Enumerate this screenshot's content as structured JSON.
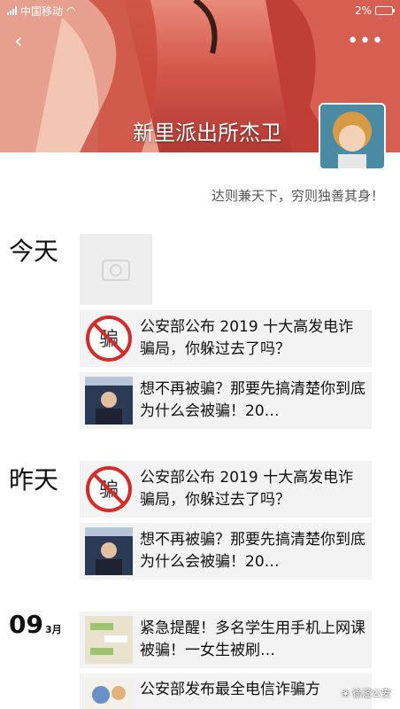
{
  "status_bar": {
    "carrier": "中国移动",
    "battery": "2%"
  },
  "header": {
    "name": "新里派出所杰卫",
    "back_icon": "back-arrow-icon",
    "more_icon": "more-dots-icon"
  },
  "signature": "达则兼天下，穷则独善其身！",
  "timeline": {
    "today": "今天",
    "yesterday": "昨天",
    "mar_day": "09",
    "mar_month": "3月"
  },
  "posts": [
    {
      "title": "公安部公布 2019 十大高发电诈骗局，你躲过去了吗？",
      "thumb": "scam-stop-icon"
    },
    {
      "title": "想不再被骗？那要先搞清楚你到底为什么会被骗！20…",
      "thumb": "news-photo"
    },
    {
      "title": "公安部公布 2019 十大高发电诈骗局，你躲过去了吗？",
      "thumb": "scam-stop-icon"
    },
    {
      "title": "想不再被骗？那要先搞清楚你到底为什么会被骗！20…",
      "thumb": "news-photo"
    },
    {
      "title": "紧急提醒！多名学生用手机上网课被骗！一女生被刷…",
      "thumb": "chat-screenshot"
    },
    {
      "title": "公安部发布最全电信诈骗方",
      "thumb": "cartoon"
    }
  ],
  "watermark": "徐泾公安",
  "colors": {
    "cover": "#d4584c",
    "card_bg": "#f3f3f3",
    "stop_red": "#d62b2b"
  }
}
